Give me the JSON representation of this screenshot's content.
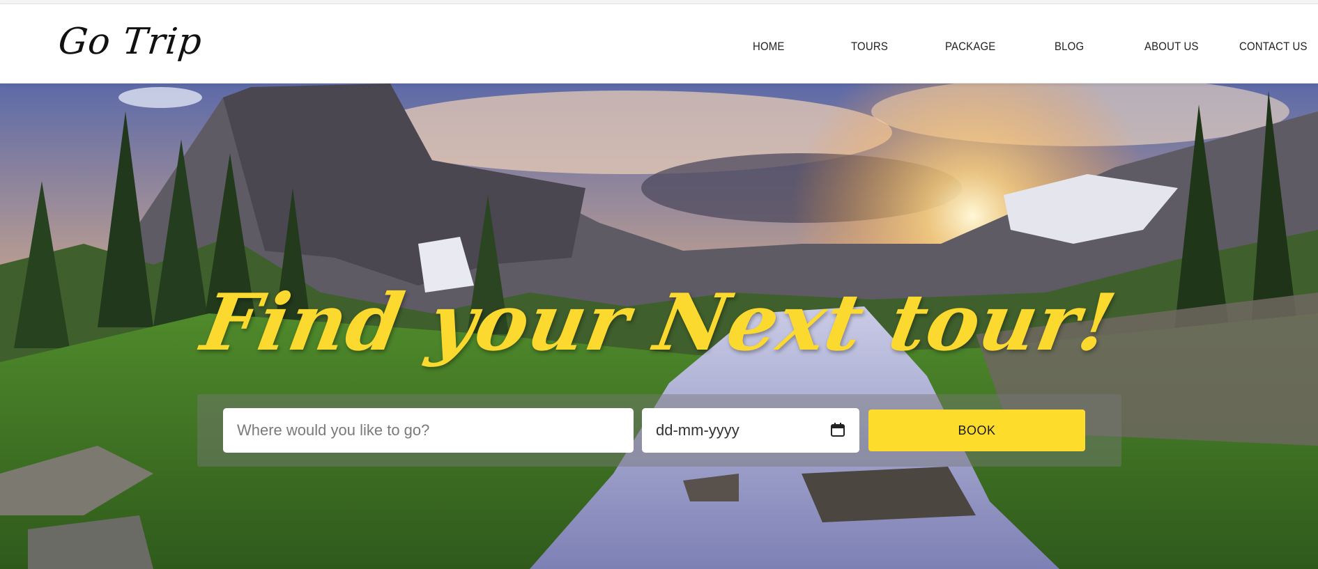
{
  "brand": {
    "logo": "Go Trip"
  },
  "nav": {
    "items": [
      {
        "label": "HOME"
      },
      {
        "label": "TOURS"
      },
      {
        "label": "PACKAGE"
      },
      {
        "label": "BLOG"
      },
      {
        "label": "ABOUT US"
      },
      {
        "label": "CONTACT US"
      }
    ]
  },
  "hero": {
    "headline": "Find your Next tour!",
    "search": {
      "destination_placeholder": "Where would you like to go?",
      "date_placeholder": "dd-mm-yyyy",
      "book_label": "BOOK"
    }
  },
  "colors": {
    "accent": "#fddc2c",
    "headline": "#fcd92f",
    "nav_text": "#222222"
  },
  "icons": {
    "date": "calendar-icon"
  }
}
